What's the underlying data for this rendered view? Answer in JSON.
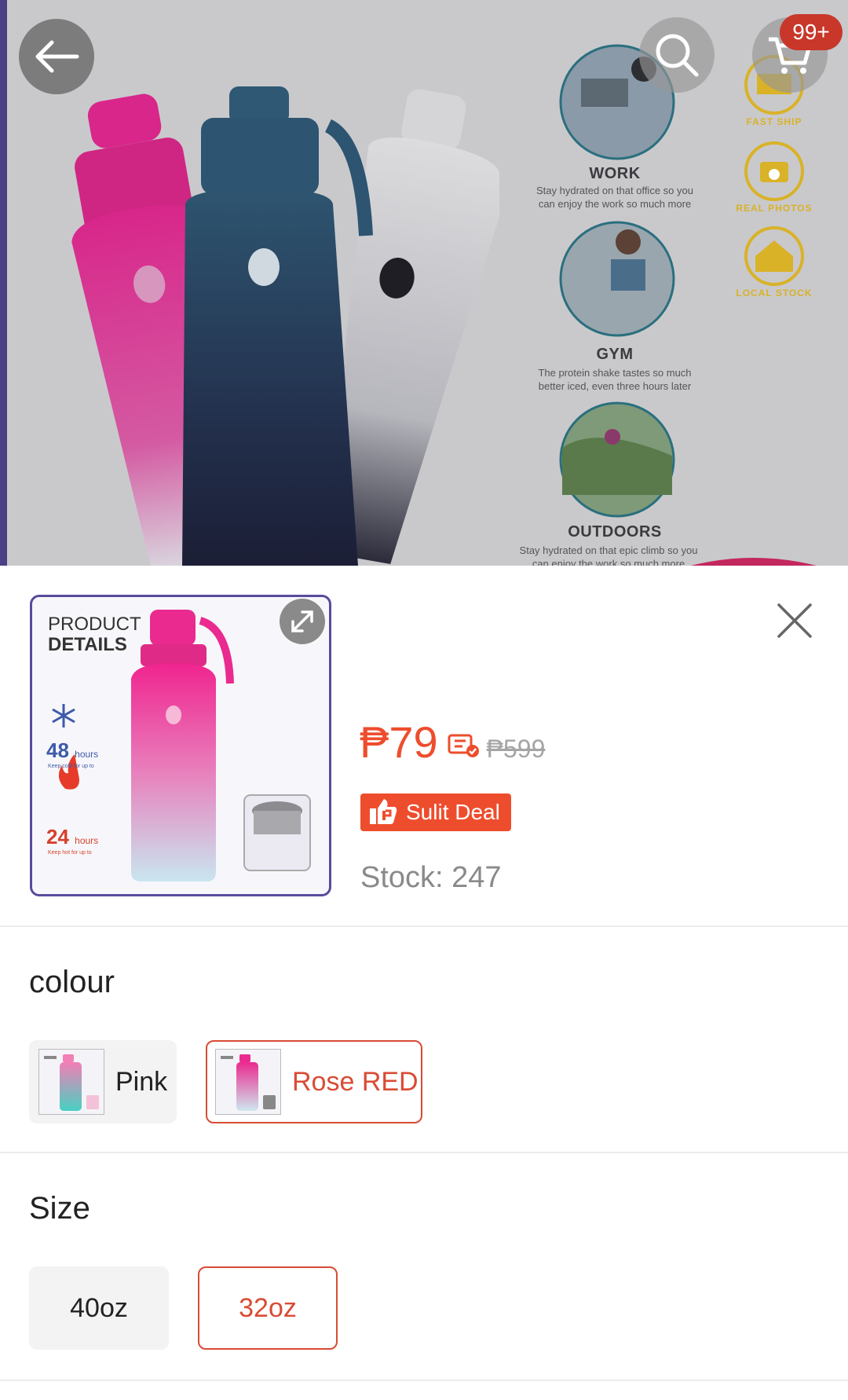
{
  "header": {
    "cart_count": "99+"
  },
  "banner": {
    "activities": [
      {
        "title": "WORK",
        "desc": "Stay hydrated on that office so you can enjoy the work so much more"
      },
      {
        "title": "GYM",
        "desc": "The protein shake tastes so much better iced, even three hours later"
      },
      {
        "title": "OUTDOORS",
        "desc": "Stay hydrated on that epic climb so you can enjoy the work so much more"
      }
    ],
    "badges": [
      "FAST SHIP",
      "REAL PHOTOS",
      "LOCAL STOCK"
    ]
  },
  "product": {
    "thumb_title_line1": "PRODUCT",
    "thumb_title_line2": "DETAILS",
    "cold_hours": "48",
    "cold_unit": "hours",
    "cold_sub": "Keep cold for up to",
    "hot_hours": "24",
    "hot_unit": "hours",
    "hot_sub": "Keep hot for up to",
    "price": "₱79",
    "original_price": "₱599",
    "deal_label": "Sulit Deal",
    "stock": "Stock: 247"
  },
  "colour": {
    "title": "colour",
    "options": [
      {
        "label": "Pink",
        "selected": false
      },
      {
        "label": "Rose RED",
        "selected": true
      }
    ]
  },
  "size": {
    "title": "Size",
    "options": [
      {
        "label": "40oz",
        "selected": false
      },
      {
        "label": "32oz",
        "selected": true
      }
    ]
  },
  "colors": {
    "accent": "#ee4d2d",
    "selected_border": "#d94b35",
    "thumb_border": "#5a4b9c"
  }
}
